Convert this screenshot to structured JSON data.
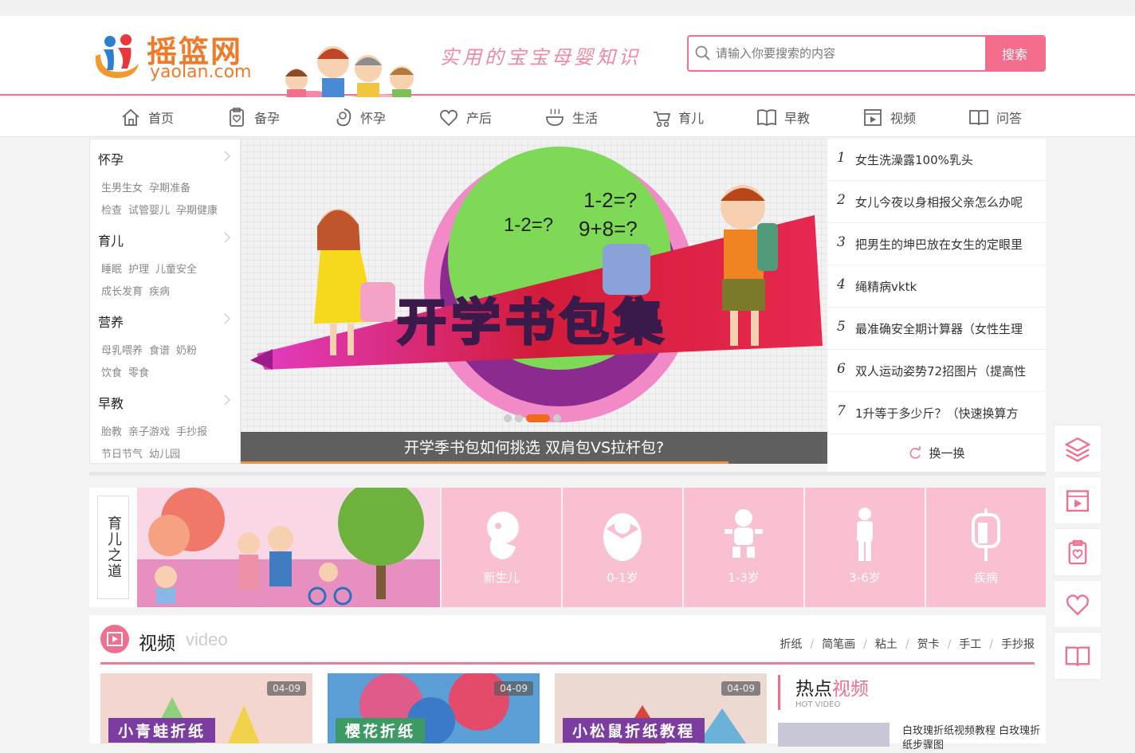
{
  "header": {
    "logo_cn": "摇篮网",
    "logo_en": "yaolan.com",
    "slogan": "实用的宝宝母婴知识",
    "search_placeholder": "请输入你要搜索的内容",
    "search_button": "搜索"
  },
  "nav": [
    {
      "label": "首页",
      "icon": "home-icon"
    },
    {
      "label": "备孕",
      "icon": "clipboard-heart-icon"
    },
    {
      "label": "怀孕",
      "icon": "fetus-icon"
    },
    {
      "label": "产后",
      "icon": "heart-hand-icon"
    },
    {
      "label": "生活",
      "icon": "bowl-icon"
    },
    {
      "label": "育儿",
      "icon": "stroller-icon"
    },
    {
      "label": "早教",
      "icon": "book-icon"
    },
    {
      "label": "视频",
      "icon": "video-icon"
    },
    {
      "label": "问答",
      "icon": "open-book-icon"
    }
  ],
  "sidebar": [
    {
      "title": "怀孕",
      "row1": [
        "生男生女",
        "孕期准备"
      ],
      "row2": [
        "检查",
        "试管婴儿",
        "孕期健康"
      ]
    },
    {
      "title": "育儿",
      "row1": [
        "睡眠",
        "护理",
        "儿童安全"
      ],
      "row2": [
        "成长发育",
        "疾病"
      ]
    },
    {
      "title": "营养",
      "row1": [
        "母乳喂养",
        "食谱",
        "奶粉"
      ],
      "row2": [
        "饮食",
        "零食"
      ]
    },
    {
      "title": "早教",
      "row1": [
        "胎教",
        "亲子游戏",
        "手抄报"
      ],
      "row2": [
        "节日节气",
        "幼儿园"
      ]
    }
  ],
  "banner": {
    "headline": "开学书包集",
    "eq1": "1-2=?",
    "eq2": "1-2=?",
    "eq3": "9+8=?",
    "caption": "开学季书包如何挑选 双肩包VS拉杆包?",
    "active_slide": 3,
    "slide_count": 4
  },
  "hot_list": [
    {
      "num": "1",
      "text": "女生洗澡露100%乳头"
    },
    {
      "num": "2",
      "text": "女儿今夜以身相报父亲怎么办呢"
    },
    {
      "num": "3",
      "text": "把男生的坤巴放在女生的定眼里"
    },
    {
      "num": "4",
      "text": "绳精病vktk"
    },
    {
      "num": "5",
      "text": "最准确安全期计算器（女性生理"
    },
    {
      "num": "6",
      "text": "双人运动姿势72招图片（提高性"
    },
    {
      "num": "7",
      "text": "1升等于多少斤？（快速换算方"
    }
  ],
  "swap_label": "换一换",
  "yuer": {
    "label": "育儿之道",
    "tiles": [
      {
        "label": "新生儿",
        "icon": "fetus-icon"
      },
      {
        "label": "0-1岁",
        "icon": "swaddled-baby-icon"
      },
      {
        "label": "1-3岁",
        "icon": "toddler-icon"
      },
      {
        "label": "3-6岁",
        "icon": "child-icon"
      },
      {
        "label": "疾病",
        "icon": "iv-drip-icon"
      }
    ]
  },
  "video": {
    "title": "视频",
    "title_en": "video",
    "tags": [
      "折纸",
      "简笔画",
      "粘土",
      "贺卡",
      "手工",
      "手抄报"
    ],
    "cards": [
      {
        "date": "04-09",
        "title": "小青蛙折纸",
        "bg": "#f3d6cf",
        "tag_bg": "#7b3da0"
      },
      {
        "date": "04-09",
        "title": "樱花折纸",
        "bg": "#5a9fd6",
        "tag_bg": "#3d9a62"
      },
      {
        "date": "04-09",
        "title": "小松鼠折纸教程",
        "bg": "#ecd9d2",
        "tag_bg": "#7b3da0"
      }
    ],
    "hot": {
      "title_a": "热点",
      "title_b": "视频",
      "subtitle": "HOT VIDEO",
      "desc": "白玫瑰折纸视频教程 白玫瑰折纸步骤图"
    }
  },
  "right_rail": [
    "layers-icon",
    "video-icon",
    "clipboard-heart-icon",
    "heart-hand-icon",
    "open-book-icon"
  ],
  "colors": {
    "accent": "#ef6f8e",
    "brand": "#ef7a2a",
    "tile": "#f8c0d0"
  }
}
